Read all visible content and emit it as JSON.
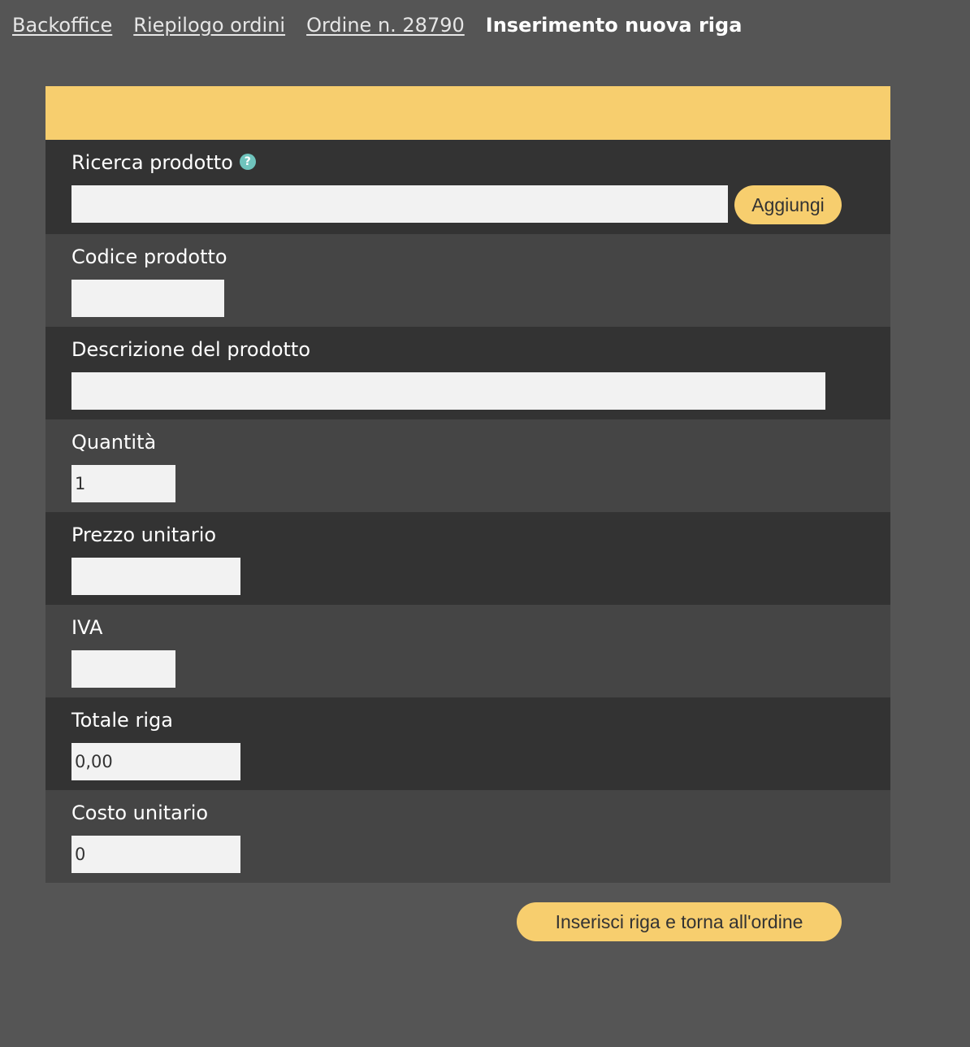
{
  "breadcrumb": {
    "items": [
      "Backoffice",
      "Riepilogo ordini",
      "Ordine n. 28790"
    ],
    "current": "Inserimento nuova riga"
  },
  "form": {
    "search": {
      "label": "Ricerca prodotto",
      "help_icon": "?",
      "value": "",
      "add_button": "Aggiungi"
    },
    "product_code": {
      "label": "Codice prodotto",
      "value": ""
    },
    "description": {
      "label": "Descrizione del prodotto",
      "value": ""
    },
    "quantity": {
      "label": "Quantità",
      "value": "1"
    },
    "unit_price": {
      "label": "Prezzo unitario",
      "value": ""
    },
    "vat": {
      "label": "IVA",
      "value": ""
    },
    "row_total": {
      "label": "Totale riga",
      "value": "0,00"
    },
    "unit_cost": {
      "label": "Costo unitario",
      "value": "0"
    }
  },
  "submit_button": "Inserisci riga e torna all'ordine",
  "colors": {
    "accent": "#f7ce6e",
    "background": "#555555",
    "row_dark": "#333333",
    "row_mid": "#454545",
    "help": "#6fc4bd"
  }
}
